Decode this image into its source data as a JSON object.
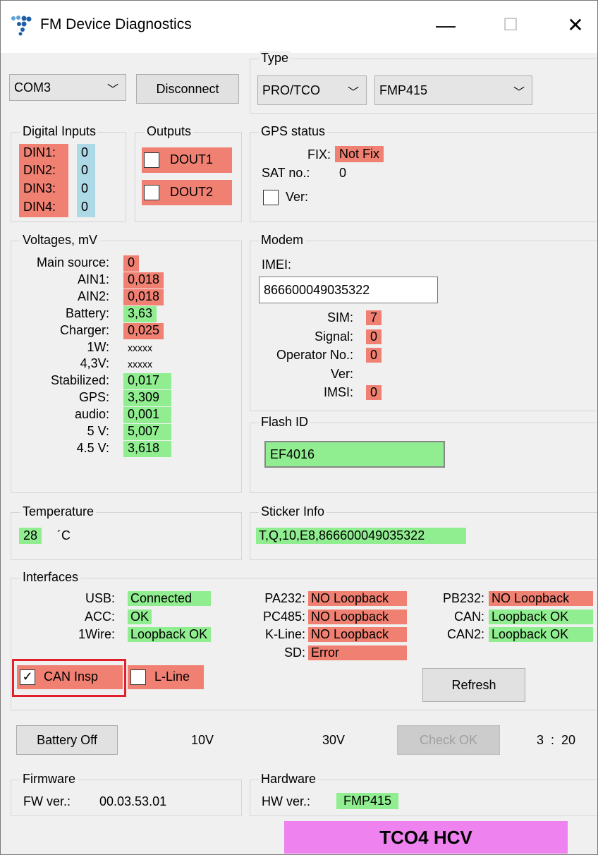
{
  "window": {
    "title": "FM Device Diagnostics",
    "minimize": "—",
    "maximize": "☐",
    "close": "✕"
  },
  "connection": {
    "port": "COM3",
    "disconnect_label": "Disconnect"
  },
  "type": {
    "legend": "Type",
    "protocol": "PRO/TCO",
    "model": "FMP415"
  },
  "digital_inputs": {
    "legend": "Digital Inputs",
    "items": [
      {
        "label": "DIN1:",
        "value": "0"
      },
      {
        "label": "DIN2:",
        "value": "0"
      },
      {
        "label": "DIN3:",
        "value": "0"
      },
      {
        "label": "DIN4:",
        "value": "0"
      }
    ]
  },
  "outputs": {
    "legend": "Outputs",
    "items": [
      {
        "label": "DOUT1",
        "checked": false
      },
      {
        "label": "DOUT2",
        "checked": false
      }
    ]
  },
  "gps": {
    "legend": "GPS status",
    "fix_label": "FIX:",
    "fix_value": "Not Fix",
    "sat_label": "SAT no.:",
    "sat_value": "0",
    "ver_label": "Ver:"
  },
  "voltages": {
    "legend": "Voltages, mV",
    "items": [
      {
        "label": "Main source:",
        "value": "0",
        "status": "red"
      },
      {
        "label": "AIN1:",
        "value": "0,018",
        "status": "red"
      },
      {
        "label": "AIN2:",
        "value": "0,018",
        "status": "red"
      },
      {
        "label": "Battery:",
        "value": "3,63",
        "status": "green"
      },
      {
        "label": "Charger:",
        "value": "0,025",
        "status": "red"
      },
      {
        "label": "1W:",
        "value": "xxxxx",
        "status": "none"
      },
      {
        "label": "4,3V:",
        "value": "xxxxx",
        "status": "none"
      },
      {
        "label": "Stabilized:",
        "value": "0,017",
        "status": "green"
      },
      {
        "label": "GPS:",
        "value": "3,309",
        "status": "green"
      },
      {
        "label": "audio:",
        "value": "0,001",
        "status": "green"
      },
      {
        "label": "5 V:",
        "value": "5,007",
        "status": "green"
      },
      {
        "label": "4.5 V:",
        "value": "3,618",
        "status": "green"
      }
    ]
  },
  "modem": {
    "legend": "Modem",
    "imei_label": "IMEI:",
    "imei_value": "866600049035322",
    "items": [
      {
        "label": "SIM:",
        "value": "7",
        "status": "red"
      },
      {
        "label": "Signal:",
        "value": "0",
        "status": "red"
      },
      {
        "label": "Operator No.:",
        "value": "0",
        "status": "red"
      },
      {
        "label": "Ver:",
        "value": "",
        "status": "none"
      },
      {
        "label": "IMSI:",
        "value": "0",
        "status": "red"
      }
    ]
  },
  "flash": {
    "legend": "Flash ID",
    "value": "EF4016"
  },
  "temperature": {
    "legend": "Temperature",
    "value": "28",
    "unit": "´C"
  },
  "sticker": {
    "legend": "Sticker Info",
    "value": "T,Q,10,E8,866600049035322"
  },
  "interfaces": {
    "legend": "Interfaces",
    "col1": [
      {
        "label": "USB:",
        "value": "Connected",
        "status": "green"
      },
      {
        "label": "ACC:",
        "value": "OK",
        "status": "green"
      },
      {
        "label": "1Wire:",
        "value": "Loopback OK",
        "status": "green"
      }
    ],
    "col2": [
      {
        "label": "PA232:",
        "value": "NO Loopback",
        "status": "red"
      },
      {
        "label": "PC485:",
        "value": "NO Loopback",
        "status": "red"
      },
      {
        "label": "K-Line:",
        "value": "NO Loopback",
        "status": "red"
      },
      {
        "label": "SD:",
        "value": "Error",
        "status": "red"
      }
    ],
    "col3": [
      {
        "label": "PB232:",
        "value": "NO Loopback",
        "status": "red"
      },
      {
        "label": "CAN:",
        "value": "Loopback OK",
        "status": "green"
      },
      {
        "label": "CAN2:",
        "value": "Loopback OK",
        "status": "green"
      }
    ],
    "can_insp_label": "CAN Insp",
    "can_insp_checked": true,
    "lline_label": "L-Line",
    "lline_checked": false,
    "refresh_label": "Refresh"
  },
  "battery": {
    "off_label": "Battery Off",
    "v10": "10V",
    "v30": "30V",
    "check_label": "Check OK",
    "timer": "3  :  20"
  },
  "firmware": {
    "legend": "Firmware",
    "label": "FW ver.:",
    "value": "00.03.53.01"
  },
  "hardware": {
    "legend": "Hardware",
    "label": "HW ver.:",
    "value": "FMP415"
  },
  "banner": {
    "text": "TCO4 HCV"
  },
  "colors": {
    "red": "#f08072",
    "green": "#90ee90",
    "blue": "#add8e6",
    "banner": "#ee82ee",
    "highlight_border": "#e0202a"
  }
}
